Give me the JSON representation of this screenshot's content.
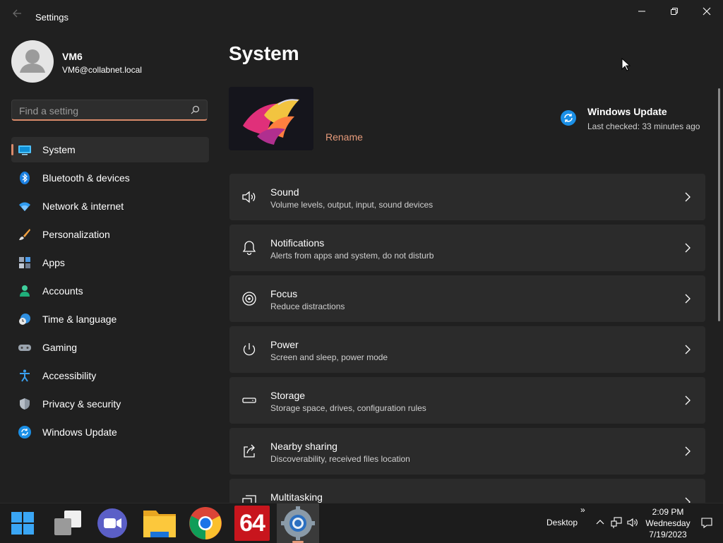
{
  "window": {
    "title": "Settings",
    "back_icon": "back-arrow-icon",
    "controls": [
      "minimize-icon",
      "restore-icon",
      "close-icon"
    ]
  },
  "profile": {
    "name": "VM6",
    "email": "VM6@collabnet.local"
  },
  "search": {
    "placeholder": "Find a setting",
    "value": ""
  },
  "nav": {
    "items": [
      {
        "label": "System",
        "icon": "system-icon",
        "selected": true
      },
      {
        "label": "Bluetooth & devices",
        "icon": "bluetooth-icon"
      },
      {
        "label": "Network & internet",
        "icon": "wifi-icon"
      },
      {
        "label": "Personalization",
        "icon": "brush-icon"
      },
      {
        "label": "Apps",
        "icon": "apps-icon"
      },
      {
        "label": "Accounts",
        "icon": "person-icon"
      },
      {
        "label": "Time & language",
        "icon": "globe-clock-icon"
      },
      {
        "label": "Gaming",
        "icon": "gamepad-icon"
      },
      {
        "label": "Accessibility",
        "icon": "accessibility-icon"
      },
      {
        "label": "Privacy & security",
        "icon": "shield-icon"
      },
      {
        "label": "Windows Update",
        "icon": "update-icon"
      }
    ]
  },
  "main": {
    "title": "System",
    "rename": "Rename",
    "windows_update": {
      "title": "Windows Update",
      "subtitle": "Last checked: 33 minutes ago"
    },
    "cards": [
      {
        "title": "Sound",
        "subtitle": "Volume levels, output, input, sound devices",
        "icon": "speaker-icon"
      },
      {
        "title": "Notifications",
        "subtitle": "Alerts from apps and system, do not disturb",
        "icon": "bell-icon"
      },
      {
        "title": "Focus",
        "subtitle": "Reduce distractions",
        "icon": "focus-icon"
      },
      {
        "title": "Power",
        "subtitle": "Screen and sleep, power mode",
        "icon": "power-icon"
      },
      {
        "title": "Storage",
        "subtitle": "Storage space, drives, configuration rules",
        "icon": "storage-icon"
      },
      {
        "title": "Nearby sharing",
        "subtitle": "Discoverability, received files location",
        "icon": "share-icon"
      },
      {
        "title": "Multitasking",
        "subtitle": "",
        "icon": "multitasking-icon"
      }
    ]
  },
  "taskbar": {
    "apps": [
      "start-icon",
      "task-view-icon",
      "teams-chat-icon",
      "file-explorer-icon",
      "chrome-icon",
      "aida64-icon",
      "settings-icon"
    ],
    "aida_label": "64",
    "desktop_label": "Desktop",
    "overflow": "»",
    "time": "2:09 PM",
    "day": "Wednesday",
    "date": "7/19/2023"
  },
  "colors": {
    "background": "#202020",
    "card": "#2b2b2b",
    "accent": "#d98a6a",
    "link": "#e59a7a"
  }
}
